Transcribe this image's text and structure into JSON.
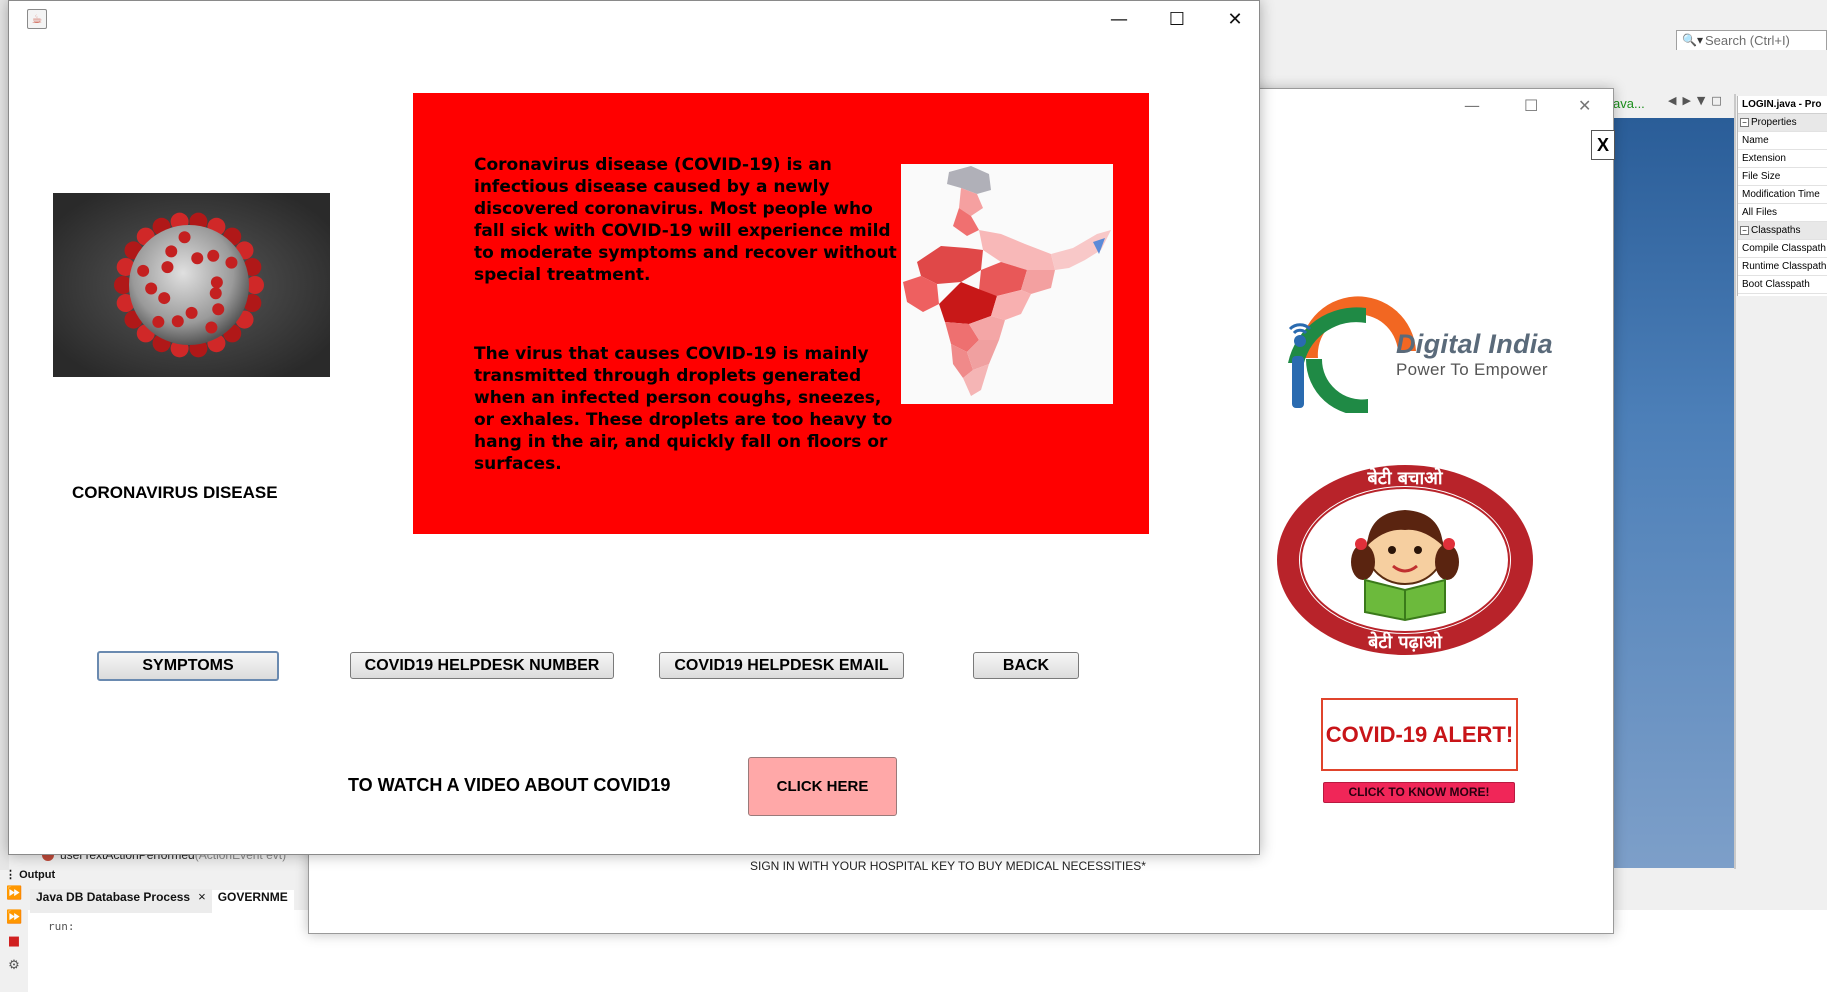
{
  "ide": {
    "search_placeholder": "Search (Ctrl+I)",
    "editor_tab_partial": "ava...",
    "properties": {
      "title": "LOGIN.java - Pro",
      "group1": "Properties",
      "rows1": [
        "Name",
        "Extension",
        "File Size",
        "Modification Time",
        "All Files"
      ],
      "group2": "Classpaths",
      "rows2": [
        "Compile Classpath",
        "Runtime Classpath",
        "Boot Classpath"
      ]
    },
    "code_line": "userTextActionPerformed",
    "code_param": "(ActionEvent evt)",
    "output_title": "Output",
    "output_tabs": [
      "Java DB Database Process",
      "GOVERNME"
    ],
    "output_text": "run:"
  },
  "login_window": {
    "close_label": "X",
    "digital_india_title": "Digital India",
    "digital_india_tagline": "Power To Empower",
    "beti_top": "बेटी बचाओ",
    "beti_bottom": "बेटी पढ़ाओ",
    "covid_alert": "COVID-19 ALERT!",
    "know_more_button": "CLICK TO KNOW MORE!",
    "signin_note": "SIGN IN WITH YOUR HOSPITAL KEY TO BUY MEDICAL NECESSITIES*"
  },
  "covid_window": {
    "heading": "CORONAVIRUS DISEASE",
    "paragraph1": "Coronavirus disease (COVID-19) is an infectious disease caused by a newly discovered coronavirus. Most people who fall sick with COVID-19 will experience mild to moderate symptoms and recover without special treatment.",
    "paragraph2": "The virus that causes COVID-19 is mainly transmitted through droplets generated when an infected person coughs, sneezes, or exhales. These droplets are too heavy to hang in the air, and quickly fall on floors or surfaces.",
    "buttons": {
      "symptoms": "SYMPTOMS",
      "helpdesk_number": "COVID19 HELPDESK NUMBER",
      "helpdesk_email": "COVID19 HELPDESK EMAIL",
      "back": "BACK"
    },
    "video_label": "TO WATCH A VIDEO ABOUT COVID19",
    "click_here": "CLICK HERE",
    "panel_color": "#ff0000",
    "click_here_color": "#ffa8a8"
  }
}
